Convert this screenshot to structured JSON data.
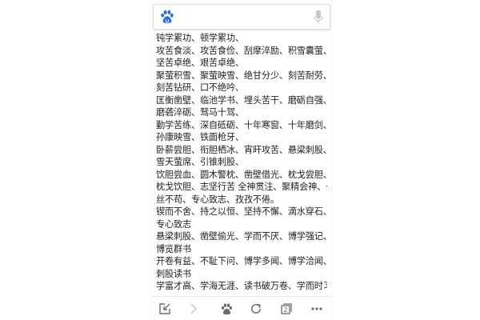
{
  "search": {
    "value": "",
    "placeholder": ""
  },
  "content": {
    "lines": [
      "钝学累功、顿学累功、",
      "攻苦食淡、攻苦食俭、刮摩淬励、积雪囊萤、",
      "坚苦卓绝、艰苦卓绝、",
      "聚萤积雪、聚萤映雪、绝甘分少、刻苦耐劳、",
      "刻苦钻研、口不绝吟、",
      "匡衡凿壁、临池学书、埋头苦干、磨砺自强、",
      "磨砻淬砺、驽马十驾、",
      "勤学苦练、深自砥砺、十年寒窗、十年磨剑、",
      "孙康映雪、铁面枪牙、",
      "卧薪尝胆、衔胆栖冰、宵旰攻苦、悬梁刺股、",
      "雪天萤席、引锥刺股、",
      "饮胆尝血、圆木警枕、凿壁借光、枕戈尝胆、",
      "枕戈饮胆、志坚行苦 全神贯注、聚精会神、一",
      "丝不苟、专心致志、孜孜不倦。",
      "锲而不舍、持之以恒、坚持不懈、滴水穿石、",
      "专心致志",
      "悬梁刺股、凿壁偷光、学而不厌、博学强记、",
      "博览群书",
      "开卷有益、不耻下问、博学多闻、博学洽闻、",
      "刺股读书",
      "学富才高、学海无涯、读书破万卷、学而时习"
    ]
  },
  "toolbar": {
    "tab_count": "2",
    "icons": [
      "minimize-icon",
      "forward-icon",
      "home-paw-icon",
      "refresh-icon",
      "tabs-icon",
      "more-icon"
    ]
  },
  "colors": {
    "logo_blue": "#2b6ed8",
    "icon_gray": "#6b6b6b",
    "icon_light": "#c8c8c8"
  }
}
